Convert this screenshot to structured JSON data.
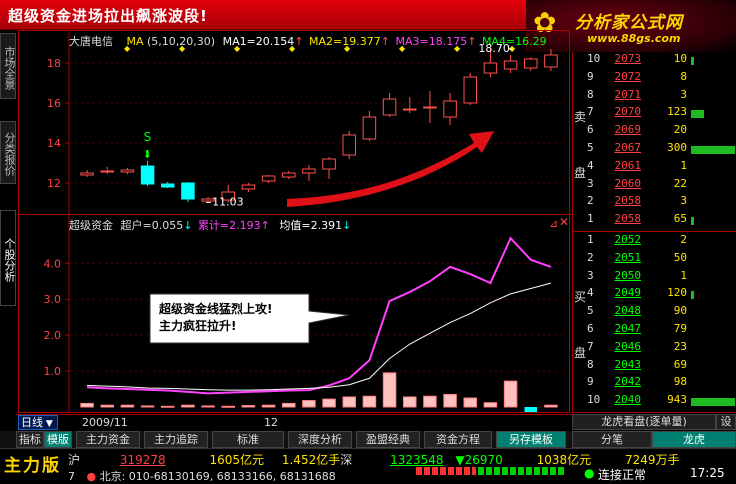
{
  "title_bar": {
    "text": "超级资金进场拉出飙涨波段!"
  },
  "logo": {
    "name": "分析家公式网",
    "url": "www.88gs.com"
  },
  "left_tabs": [
    "市场全景",
    "分类报价",
    "个股分析"
  ],
  "main_chart": {
    "stock": "大唐电信",
    "ma_label": "MA",
    "ma_params": "(5,10,20,30)",
    "ma1": "MA1=20.154",
    "ma2": "MA2=19.377",
    "ma3": "MA3=18.175",
    "ma4": "MA4=16.29",
    "y_ticks": [
      "18",
      "16",
      "14",
      "12"
    ],
    "high_label": "18.70",
    "low_label": "11.03",
    "signal": "S"
  },
  "chart_data": [
    {
      "type": "candlestick",
      "ylim": [
        10.6,
        18.9
      ],
      "candles": [
        {
          "o": 12.4,
          "h": 12.65,
          "l": 12.3,
          "c": 12.5
        },
        {
          "o": 12.55,
          "h": 12.8,
          "l": 12.45,
          "c": 12.6
        },
        {
          "o": 12.55,
          "h": 12.75,
          "l": 12.45,
          "c": 12.65
        },
        {
          "o": 12.85,
          "h": 13.1,
          "l": 11.85,
          "c": 11.95
        },
        {
          "o": 11.95,
          "h": 12.05,
          "l": 11.75,
          "c": 11.8
        },
        {
          "o": 12.0,
          "h": 12.05,
          "l": 11.05,
          "c": 11.2
        },
        {
          "o": 11.1,
          "h": 11.3,
          "l": 11.03,
          "c": 11.2
        },
        {
          "o": 11.15,
          "h": 11.9,
          "l": 11.03,
          "c": 11.55
        },
        {
          "o": 11.7,
          "h": 12.0,
          "l": 11.55,
          "c": 11.9
        },
        {
          "o": 12.1,
          "h": 12.4,
          "l": 12.0,
          "c": 12.35
        },
        {
          "o": 12.3,
          "h": 12.6,
          "l": 12.2,
          "c": 12.5
        },
        {
          "o": 12.5,
          "h": 12.9,
          "l": 12.1,
          "c": 12.7
        },
        {
          "o": 12.7,
          "h": 13.3,
          "l": 12.2,
          "c": 13.2
        },
        {
          "o": 13.4,
          "h": 14.6,
          "l": 13.2,
          "c": 14.4
        },
        {
          "o": 14.2,
          "h": 15.6,
          "l": 14.1,
          "c": 15.3
        },
        {
          "o": 15.4,
          "h": 16.5,
          "l": 15.3,
          "c": 16.2
        },
        {
          "o": 15.7,
          "h": 16.3,
          "l": 15.5,
          "c": 15.7
        },
        {
          "o": 15.8,
          "h": 16.6,
          "l": 15.0,
          "c": 15.8
        },
        {
          "o": 15.3,
          "h": 16.5,
          "l": 14.9,
          "c": 16.1
        },
        {
          "o": 16.0,
          "h": 17.5,
          "l": 15.9,
          "c": 17.3
        },
        {
          "o": 17.5,
          "h": 18.7,
          "l": 17.3,
          "c": 18.0
        },
        {
          "o": 17.7,
          "h": 18.4,
          "l": 17.5,
          "c": 18.1
        },
        {
          "o": 17.75,
          "h": 18.3,
          "l": 17.6,
          "c": 18.2
        },
        {
          "o": 17.8,
          "h": 18.7,
          "l": 17.6,
          "c": 18.4
        }
      ]
    },
    {
      "type": "line",
      "ylim": [
        0,
        4.9
      ],
      "series": [
        {
          "name": "超户",
          "values": [
            0.55,
            0.52,
            0.5,
            0.48,
            0.46,
            0.42,
            0.38,
            0.4,
            0.42,
            0.44,
            0.46,
            0.47,
            0.6,
            0.8,
            1.3,
            2.95,
            3.2,
            3.5,
            3.9,
            3.7,
            3.45,
            4.7,
            4.1,
            3.9
          ]
        },
        {
          "name": "累计",
          "values": [
            0.6,
            0.58,
            0.56,
            0.53,
            0.52,
            0.5,
            0.48,
            0.47,
            0.47,
            0.48,
            0.5,
            0.52,
            0.55,
            0.62,
            0.8,
            1.35,
            1.75,
            2.05,
            2.35,
            2.6,
            2.9,
            3.15,
            3.3,
            3.45
          ]
        }
      ],
      "bars": [
        0.1,
        0.05,
        0.05,
        0.03,
        0.02,
        0.05,
        0.03,
        0.02,
        0.04,
        0.05,
        0.1,
        0.18,
        0.22,
        0.28,
        0.3,
        0.95,
        0.28,
        0.3,
        0.35,
        0.25,
        0.12,
        0.72,
        -0.15,
        0.05
      ]
    }
  ],
  "sub_chart": {
    "name": "超级资金",
    "v1": "超户=0.055",
    "v2": "累计=2.193",
    "v3": "均值=2.391",
    "y_ticks": [
      "4.0",
      "3.0",
      "2.0",
      "1.0"
    ],
    "annotation_line1": "超级资金线猛烈上攻!",
    "annotation_line2": "主力疯狂拉升!"
  },
  "x_axis": {
    "period_button": "日线",
    "date1": "2009/11",
    "date2": "12"
  },
  "order_book": {
    "sell_label": [
      "卖",
      "盘"
    ],
    "buy_label": [
      "买",
      "盘"
    ],
    "sell": [
      {
        "lvl": "10",
        "price": "2073",
        "vol": "10",
        "bar": 0.05
      },
      {
        "lvl": "9",
        "price": "2072",
        "vol": "8",
        "bar": 0
      },
      {
        "lvl": "8",
        "price": "2071",
        "vol": "3",
        "bar": 0
      },
      {
        "lvl": "7",
        "price": "2070",
        "vol": "123",
        "bar": 0.3
      },
      {
        "lvl": "6",
        "price": "2069",
        "vol": "20",
        "bar": 0
      },
      {
        "lvl": "5",
        "price": "2067",
        "vol": "300",
        "bar": 1.0
      },
      {
        "lvl": "4",
        "price": "2061",
        "vol": "1",
        "bar": 0
      },
      {
        "lvl": "3",
        "price": "2060",
        "vol": "22",
        "bar": 0
      },
      {
        "lvl": "2",
        "price": "2058",
        "vol": "3",
        "bar": 0
      },
      {
        "lvl": "1",
        "price": "2058",
        "vol": "65",
        "bar": 0.05
      }
    ],
    "buy": [
      {
        "lvl": "1",
        "price": "2052",
        "vol": "2",
        "bar": 0
      },
      {
        "lvl": "2",
        "price": "2051",
        "vol": "50",
        "bar": 0
      },
      {
        "lvl": "3",
        "price": "2050",
        "vol": "1",
        "bar": 0
      },
      {
        "lvl": "4",
        "price": "2049",
        "vol": "120",
        "bar": 0.05
      },
      {
        "lvl": "5",
        "price": "2048",
        "vol": "90",
        "bar": 0
      },
      {
        "lvl": "6",
        "price": "2047",
        "vol": "79",
        "bar": 0
      },
      {
        "lvl": "7",
        "price": "2046",
        "vol": "23",
        "bar": 0
      },
      {
        "lvl": "8",
        "price": "2043",
        "vol": "69",
        "bar": 0
      },
      {
        "lvl": "9",
        "price": "2042",
        "vol": "98",
        "bar": 0
      },
      {
        "lvl": "10",
        "price": "2040",
        "vol": "943",
        "bar": 1.0
      }
    ],
    "footer_label": "龙虎看盘(逐单量)",
    "footer_btn": "设"
  },
  "tabs": [
    "指标",
    "模版",
    "主力资金",
    "主力追踪",
    "标准",
    "深度分析",
    "盈盟经典",
    "资金方程",
    "另存模板"
  ],
  "right_tabs": [
    "分笔",
    "龙虎"
  ],
  "status": {
    "brand": "主力版",
    "sh_label": "沪",
    "sh_index": "319278",
    "sh_amount": "1605亿元",
    "sz_amount_pre": "1.452亿手",
    "sz_label": "深",
    "sz_index": "1323548",
    "sz_change": "▼26970",
    "sz_amount": "1038亿元",
    "sz_vol": "7249万手",
    "line2_num": "7",
    "phone": "北京: 010-68130169, 68133166, 68131688",
    "conn": "连接正常",
    "time": "17:25"
  },
  "colors": {
    "up": "#ff5050",
    "down": "#00ffff",
    "ma1": "#ffffff",
    "ma2": "#ffe400",
    "ma3": "#ff40ff",
    "ma4": "#00ff00",
    "accent": "#a00000"
  }
}
